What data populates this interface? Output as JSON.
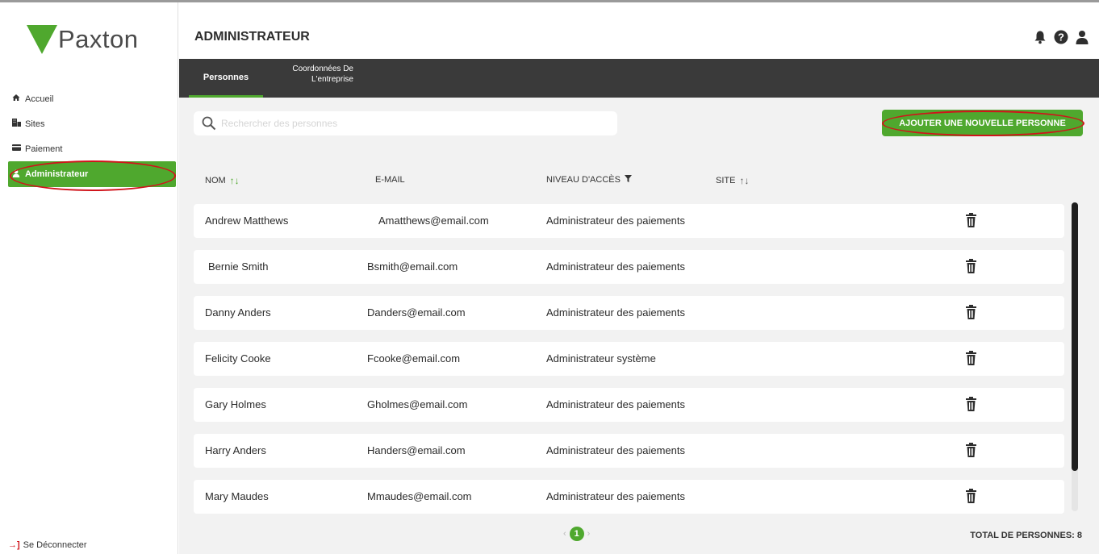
{
  "brand": {
    "name": "Paxton",
    "color": "#4fa82e"
  },
  "sidebar": {
    "items": [
      {
        "label": "Accueil",
        "icon": "home-icon"
      },
      {
        "label": "Sites",
        "icon": "building-icon"
      },
      {
        "label": "Paiement",
        "icon": "card-icon"
      },
      {
        "label": "Administrateur",
        "icon": "user-icon",
        "active": true
      }
    ],
    "logout_label": "Se Déconnecter"
  },
  "header": {
    "title": "ADMINISTRATEUR",
    "icons": [
      "bell-icon",
      "help-icon",
      "user-icon"
    ]
  },
  "tabs": [
    {
      "label": "Personnes",
      "active": true
    },
    {
      "label_line1": "Coordonnées De",
      "label_line2": "L'entreprise"
    }
  ],
  "search": {
    "placeholder": "Rechercher des personnes",
    "value": ""
  },
  "add_button_label": "AJOUTER UNE NOUVELLE PERSONNE",
  "table": {
    "headers": {
      "name": "NOM",
      "email": "E-MAIL",
      "access": "NIVEAU D'ACCÈS",
      "site": "SITE"
    },
    "rows": [
      {
        "name": "Andrew Matthews",
        "email": "Amatthews@email.com",
        "access": "Administrateur des paiements"
      },
      {
        "name": "Bernie Smith",
        "email": "Bsmith@email.com",
        "access": "Administrateur des paiements"
      },
      {
        "name": "Danny Anders",
        "email": "Danders@email.com",
        "access": "Administrateur des paiements"
      },
      {
        "name": "Felicity Cooke",
        "email": "Fcooke@email.com",
        "access": "Administrateur système"
      },
      {
        "name": "Gary Holmes",
        "email": "Gholmes@email.com",
        "access": "Administrateur des paiements"
      },
      {
        "name": "Harry Anders",
        "email": "Handers@email.com",
        "access": "Administrateur des paiements"
      },
      {
        "name": "Mary Maudes",
        "email": "Mmaudes@email.com",
        "access": "Administrateur des paiements"
      }
    ]
  },
  "pagination": {
    "current": "1",
    "prev": "‹",
    "next": "›"
  },
  "total_label": "TOTAL DE PERSONNES: 8",
  "colors": {
    "accent": "#4fa82e",
    "tabbar": "#3a3a3a",
    "annotation": "#d0141b"
  }
}
